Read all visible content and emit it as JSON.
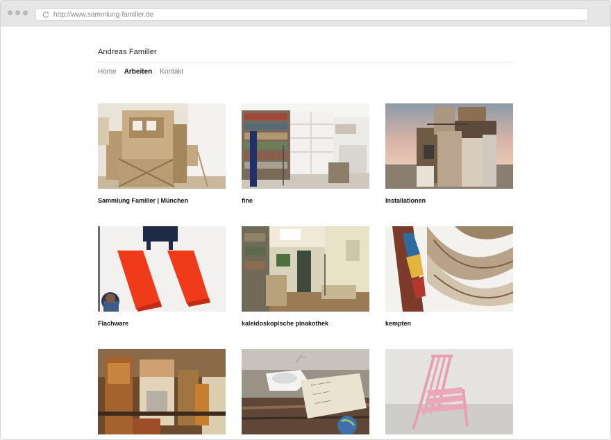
{
  "browser": {
    "url": "http://www.sammlung-familler.de"
  },
  "site": {
    "title": "Andreas Familler"
  },
  "nav": {
    "items": [
      {
        "label": "Home",
        "active": false
      },
      {
        "label": "Arbeiten",
        "active": true
      },
      {
        "label": "Kontakt",
        "active": false
      }
    ]
  },
  "works": [
    {
      "caption": "Sammlung Familler | München",
      "image": "wooden-structure-installation"
    },
    {
      "caption": "fine",
      "image": "room-with-shelves"
    },
    {
      "caption": "Installationen",
      "image": "wooden-tower-at-dusk"
    },
    {
      "caption": "Flachware",
      "image": "red-awnings-with-figure"
    },
    {
      "caption": "kaleidoskopische pinakothek",
      "image": "furnished-gallery-room"
    },
    {
      "caption": "kempten",
      "image": "curved-wood-panels"
    },
    {
      "caption": "",
      "image": "cluttered-workshop"
    },
    {
      "caption": "",
      "image": "sink-with-handwritten-sign"
    },
    {
      "caption": "",
      "image": "pink-chair-sculpture"
    }
  ],
  "colors": {
    "chrome": "#e6e6e6",
    "text": "#111111",
    "nav_inactive": "#777777",
    "rule": "#e3e3e3"
  }
}
